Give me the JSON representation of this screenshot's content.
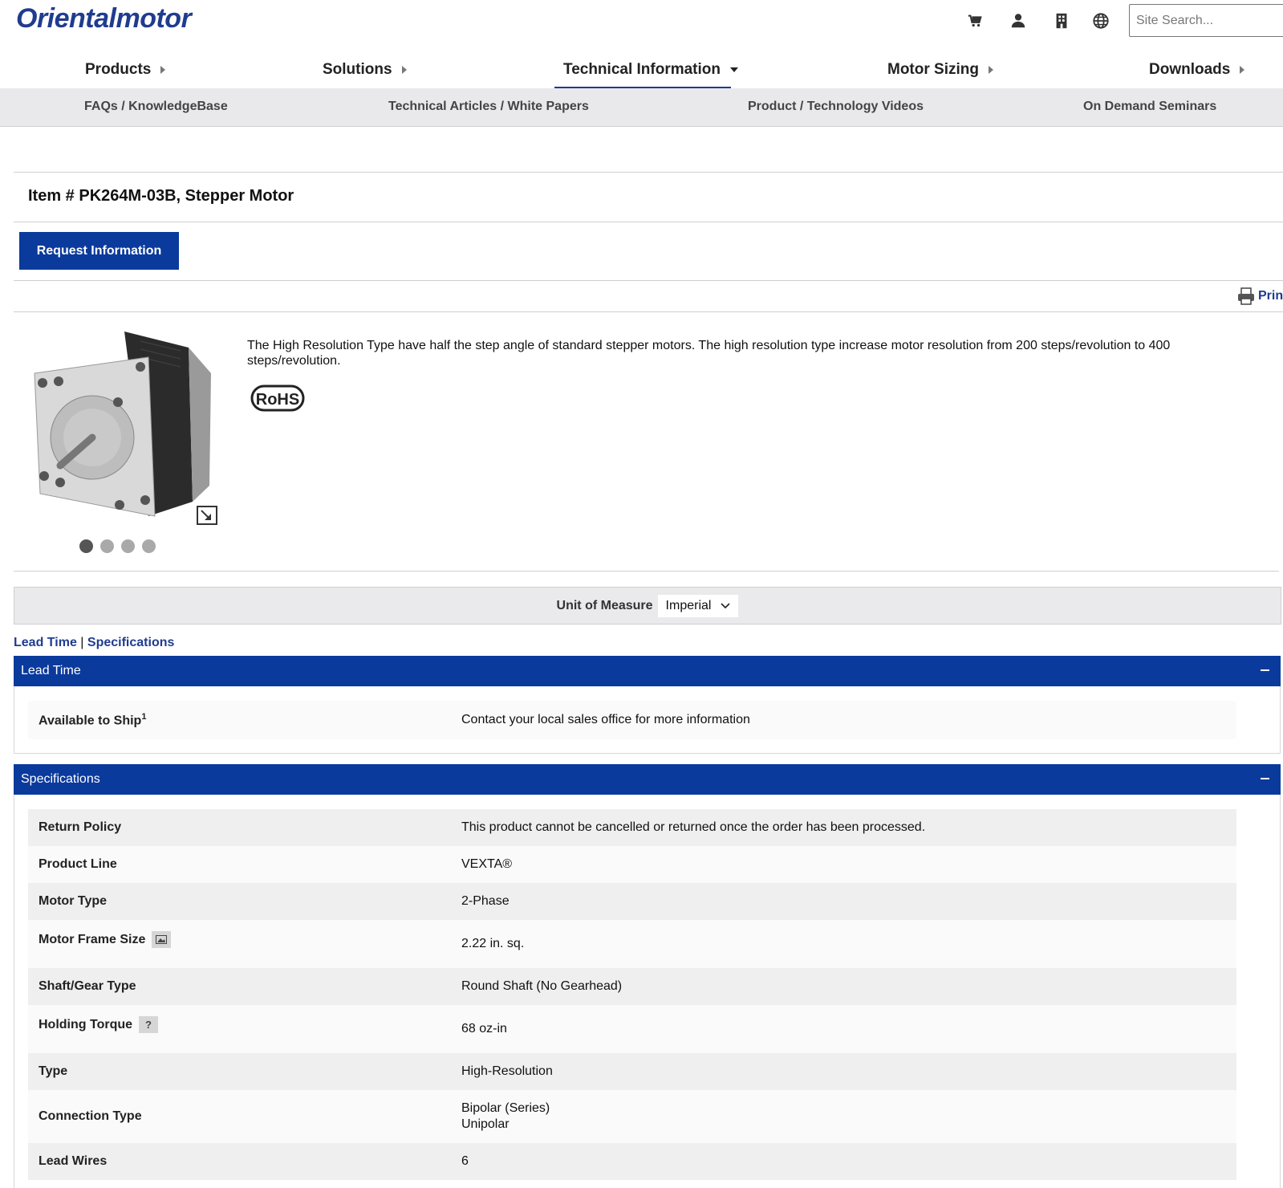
{
  "header": {
    "logo": "Orientalmotor",
    "search_placeholder": "Site Search..."
  },
  "main_nav": [
    {
      "label": "Products"
    },
    {
      "label": "Solutions"
    },
    {
      "label": "Technical Information"
    },
    {
      "label": "Motor Sizing"
    },
    {
      "label": "Downloads"
    }
  ],
  "sub_nav": [
    {
      "label": "FAQs / KnowledgeBase"
    },
    {
      "label": "Technical Articles / White Papers"
    },
    {
      "label": "Product / Technology Videos"
    },
    {
      "label": "On Demand Seminars"
    }
  ],
  "product": {
    "title": "Item # PK264M-03B, Stepper Motor",
    "request_button": "Request Information",
    "print_label": "Prin",
    "description": "The High Resolution Type have half the step angle of standard stepper motors. The high resolution type increase motor resolution from 200 steps/revolution to 400 steps/revolution.",
    "badge": "RoHS"
  },
  "unit_of_measure": {
    "label": "Unit of Measure",
    "value": "Imperial"
  },
  "anchors": {
    "lead_time": "Lead Time",
    "separator": "|",
    "specifications": "Specifications"
  },
  "lead_time": {
    "title": "Lead Time",
    "rows": [
      {
        "key": "Available to Ship",
        "sup": "1",
        "value": "Contact your local sales office for more information"
      }
    ]
  },
  "specifications": {
    "title": "Specifications",
    "rows": [
      {
        "key": "Return Policy",
        "value": "This product cannot be cancelled or returned once the order has been processed."
      },
      {
        "key": "Product Line",
        "value": "VEXTA®"
      },
      {
        "key": "Motor Type",
        "value": "2-Phase"
      },
      {
        "key": "Motor Frame Size",
        "value": "2.22 in. sq."
      },
      {
        "key": "Shaft/Gear Type",
        "value": "Round Shaft (No Gearhead)"
      },
      {
        "key": "Holding Torque",
        "help": "?",
        "value": "68 oz-in"
      },
      {
        "key": "Type",
        "value": "High-Resolution"
      },
      {
        "key": "Connection Type",
        "value": "Bipolar (Series)",
        "value2": "Unipolar"
      },
      {
        "key": "Lead Wires",
        "value": "6"
      }
    ]
  },
  "colors": {
    "brand_blue": "#0a3a9c",
    "logo_blue": "#1f3c8f"
  }
}
